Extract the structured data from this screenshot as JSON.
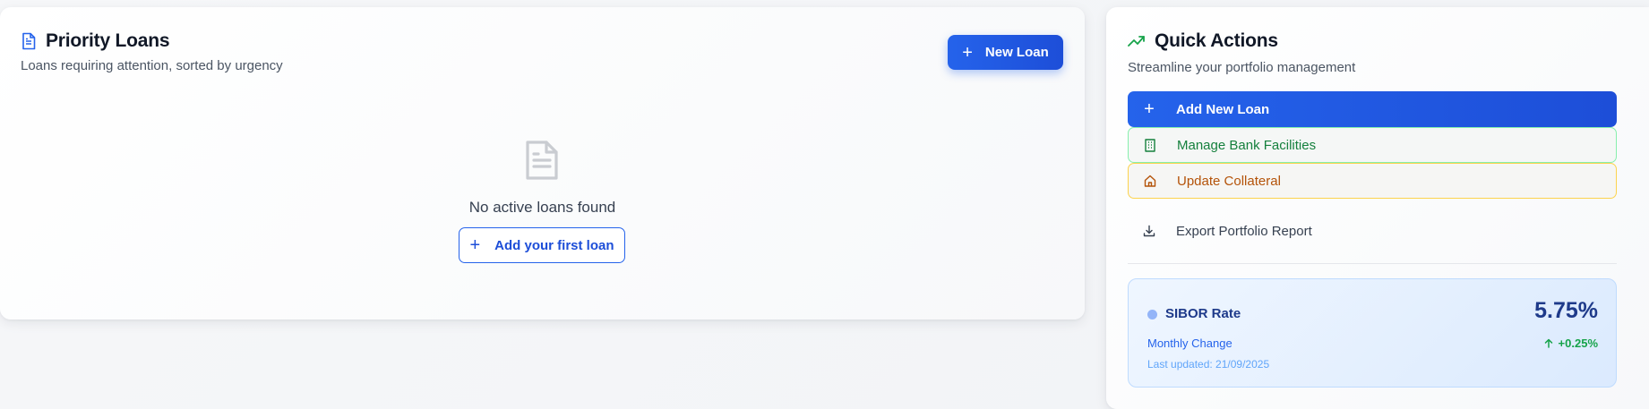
{
  "priority_loans": {
    "title": "Priority Loans",
    "subtitle": "Loans requiring attention, sorted by urgency",
    "new_loan_label": "New Loan",
    "empty_text": "No active loans found",
    "add_first_label": "Add your first loan",
    "header_icon": "document-icon",
    "empty_icon": "document-icon"
  },
  "quick_actions": {
    "title": "Quick Actions",
    "subtitle": "Streamline your portfolio management",
    "header_icon": "trending-up-icon",
    "actions": [
      {
        "label": "Add New Loan",
        "icon": "plus-icon",
        "color": "#2563eb"
      },
      {
        "label": "Manage Bank Facilities",
        "icon": "building-icon",
        "color": "#15803d"
      },
      {
        "label": "Update Collateral",
        "icon": "home-icon",
        "color": "#b45309"
      },
      {
        "label": "Export Portfolio Report",
        "icon": "download-icon",
        "color": "#374151"
      }
    ]
  },
  "sibor": {
    "label": "SIBOR Rate",
    "rate": "5.75%",
    "change_label": "Monthly Change",
    "change": "+0.25%",
    "updated": "Last updated: 21/09/2025"
  },
  "colors": {
    "primary": "#2563eb",
    "success": "#16a34a",
    "warning": "#b45309"
  }
}
